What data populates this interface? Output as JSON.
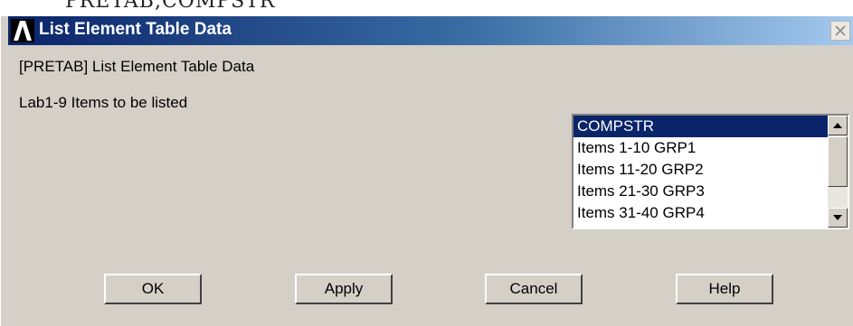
{
  "command_line": {
    "text": "PRETAB,COMPSTR"
  },
  "window": {
    "title": "List Element Table Data",
    "logo_icon": "ansys-logo-icon",
    "close_icon": "close-icon"
  },
  "form": {
    "command_label": "[PRETAB]  List Element Table Data",
    "items_label": "Lab1-9  Items to be listed"
  },
  "listbox": {
    "selected_index": 0,
    "items": [
      "COMPSTR",
      "Items  1-10 GRP1",
      "Items 11-20 GRP2",
      "Items 21-30 GRP3",
      "Items 31-40 GRP4"
    ]
  },
  "buttons": {
    "ok": "OK",
    "apply": "Apply",
    "cancel": "Cancel",
    "help": "Help"
  },
  "colors": {
    "title_bar": "#0a246a",
    "selection": "#0a246a",
    "dialog_bg": "#d4d0c8"
  }
}
